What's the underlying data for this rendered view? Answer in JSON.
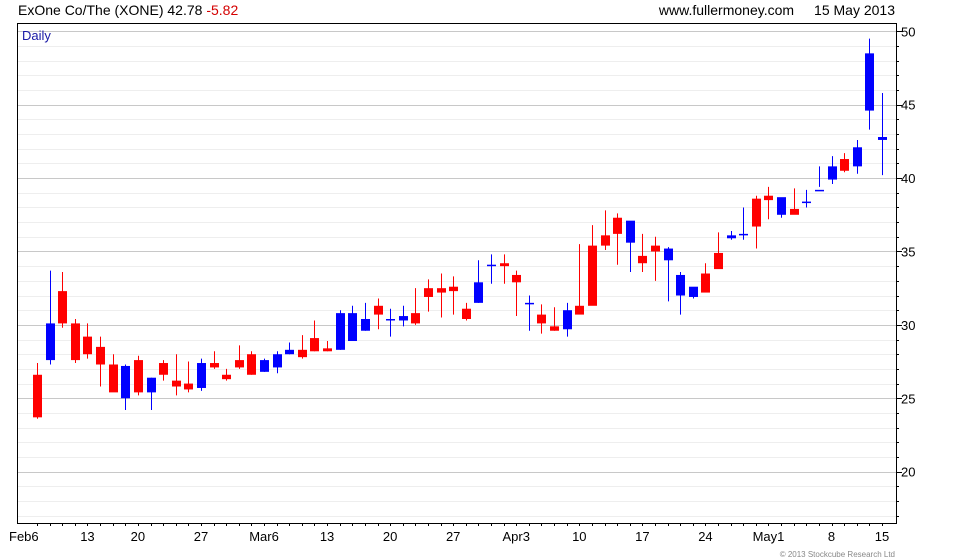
{
  "header": {
    "title": "ExOne Co/The (XONE)",
    "price": "42.78",
    "change": "-5.82",
    "site": "www.fullermoney.com",
    "date": "15 May 2013"
  },
  "footer": {
    "copyright": "© 2013 Stockcube Research Ltd"
  },
  "colors": {
    "up": "#0000ff",
    "down": "#ff0000",
    "grid": "#c8c8c8",
    "frame": "#000000"
  },
  "chart_data": {
    "type": "candlestick",
    "period_label": "Daily",
    "ylim": [
      16.5,
      50.5
    ],
    "y_ticks": [
      20,
      25,
      30,
      35,
      40,
      45,
      50
    ],
    "x_tick_labels": [
      "Feb6",
      "13",
      "20",
      "27",
      "Mar6",
      "13",
      "20",
      "27",
      "Apr3",
      "10",
      "17",
      "24",
      "May1",
      "8",
      "15"
    ],
    "grid": "horizontal",
    "dates": [
      "Feb 7",
      "Feb 8",
      "Feb 11",
      "Feb 12",
      "Feb 13",
      "Feb 14",
      "Feb 15",
      "Feb 19",
      "Feb 20",
      "Feb 21",
      "Feb 22",
      "Feb 25",
      "Feb 26",
      "Feb 27",
      "Feb 28",
      "Mar 1",
      "Mar 4",
      "Mar 5",
      "Mar 6",
      "Mar 7",
      "Mar 8",
      "Mar 11",
      "Mar 12",
      "Mar 13",
      "Mar 14",
      "Mar 15",
      "Mar 18",
      "Mar 19",
      "Mar 20",
      "Mar 21",
      "Mar 22",
      "Mar 25",
      "Mar 26",
      "Mar 27",
      "Mar 28",
      "Apr 1",
      "Apr 2",
      "Apr 3",
      "Apr 4",
      "Apr 5",
      "Apr 8",
      "Apr 9",
      "Apr 10",
      "Apr 11",
      "Apr 12",
      "Apr 15",
      "Apr 16",
      "Apr 17",
      "Apr 18",
      "Apr 19",
      "Apr 22",
      "Apr 23",
      "Apr 24",
      "Apr 25",
      "Apr 26",
      "Apr 29",
      "Apr 30",
      "May 1",
      "May 2",
      "May 3",
      "May 6",
      "May 7",
      "May 8",
      "May 9",
      "May 10",
      "May 13",
      "May 14",
      "May 15"
    ],
    "open": [
      26.6,
      27.6,
      32.3,
      30.1,
      29.2,
      28.5,
      27.3,
      25.0,
      27.6,
      25.4,
      27.4,
      26.2,
      26.0,
      25.7,
      27.4,
      26.6,
      27.6,
      28.0,
      26.8,
      27.1,
      28.0,
      28.3,
      29.1,
      28.4,
      28.3,
      28.9,
      29.6,
      31.3,
      30.4,
      30.3,
      30.8,
      32.5,
      32.5,
      32.6,
      31.1,
      31.5,
      34.1,
      34.2,
      33.4,
      31.5,
      30.7,
      29.9,
      29.7,
      31.3,
      35.4,
      36.1,
      37.3,
      35.6,
      34.7,
      35.4,
      34.4,
      32.0,
      31.9,
      33.5,
      34.9,
      35.9,
      36.1,
      38.6,
      38.8,
      37.5,
      37.9,
      38.3,
      39.2,
      39.9,
      41.3,
      40.8,
      44.6,
      42.6
    ],
    "high": [
      27.4,
      33.7,
      33.6,
      30.4,
      30.1,
      29.2,
      28.0,
      27.3,
      27.9,
      26.4,
      27.6,
      28.0,
      27.5,
      27.7,
      28.2,
      27.0,
      28.6,
      28.2,
      27.7,
      28.2,
      28.8,
      29.3,
      30.3,
      28.9,
      31.0,
      31.3,
      31.5,
      31.8,
      31.1,
      31.3,
      32.5,
      33.1,
      33.5,
      33.3,
      31.5,
      34.4,
      34.8,
      34.8,
      33.7,
      32.0,
      31.4,
      31.2,
      31.5,
      35.5,
      36.8,
      37.8,
      37.6,
      36.5,
      36.2,
      36.0,
      35.3,
      33.6,
      32.3,
      34.2,
      36.3,
      36.4,
      38.0,
      38.8,
      39.4,
      38.2,
      39.3,
      39.2,
      40.8,
      41.5,
      41.7,
      42.6,
      49.5,
      45.8
    ],
    "low": [
      23.6,
      27.3,
      29.8,
      27.4,
      27.7,
      25.8,
      25.6,
      24.2,
      25.2,
      24.2,
      26.2,
      25.2,
      25.4,
      25.5,
      27.0,
      26.2,
      27.0,
      26.6,
      26.8,
      26.7,
      28.0,
      27.7,
      28.2,
      28.2,
      28.3,
      28.9,
      29.6,
      29.7,
      29.2,
      29.9,
      30.0,
      30.9,
      30.5,
      30.7,
      30.3,
      31.5,
      32.8,
      32.8,
      30.6,
      29.6,
      29.4,
      29.6,
      29.2,
      31.1,
      33.9,
      35.1,
      34.1,
      33.6,
      33.6,
      33.0,
      31.6,
      30.7,
      31.8,
      33.5,
      34.4,
      35.8,
      35.8,
      35.2,
      37.2,
      37.3,
      37.8,
      38.0,
      39.4,
      39.6,
      40.4,
      40.3,
      43.3,
      40.2
    ],
    "close": [
      23.7,
      30.1,
      30.1,
      27.6,
      28.0,
      27.3,
      25.4,
      27.2,
      25.4,
      26.4,
      26.6,
      25.8,
      25.6,
      27.4,
      27.1,
      26.3,
      27.1,
      26.6,
      27.6,
      28.0,
      28.3,
      27.8,
      28.2,
      28.2,
      30.8,
      30.8,
      30.4,
      30.7,
      30.4,
      30.6,
      30.1,
      31.9,
      32.2,
      32.3,
      30.4,
      32.9,
      34.1,
      34.0,
      32.9,
      31.5,
      30.1,
      29.6,
      31.0,
      30.7,
      31.3,
      35.4,
      36.2,
      37.1,
      34.2,
      35.0,
      35.2,
      33.4,
      32.6,
      32.2,
      33.8,
      36.1,
      36.2,
      36.7,
      38.5,
      38.7,
      37.5,
      38.4,
      39.2,
      40.8,
      40.5,
      42.1,
      48.5,
      42.8
    ]
  }
}
